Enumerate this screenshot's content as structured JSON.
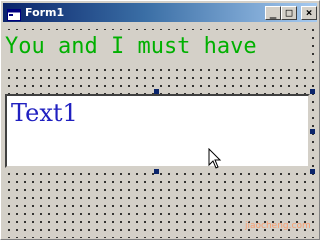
{
  "window": {
    "title": "Form1",
    "buttons": {
      "minimize_glyph": "_",
      "maximize_glyph": "□",
      "close_glyph": "×"
    }
  },
  "form": {
    "label1": {
      "caption": "You and I must have",
      "color": "#00b000"
    },
    "text1": {
      "value": "Text1",
      "color": "#2020c0"
    }
  },
  "icons": {
    "title": "form-icon",
    "cursor": "arrow-cursor-icon"
  },
  "watermark": {
    "text": "jiaocheng.com"
  },
  "colors": {
    "titlebar_start": "#0a246a",
    "titlebar_end": "#a6caf0",
    "selection_handle": "#0a246a"
  }
}
